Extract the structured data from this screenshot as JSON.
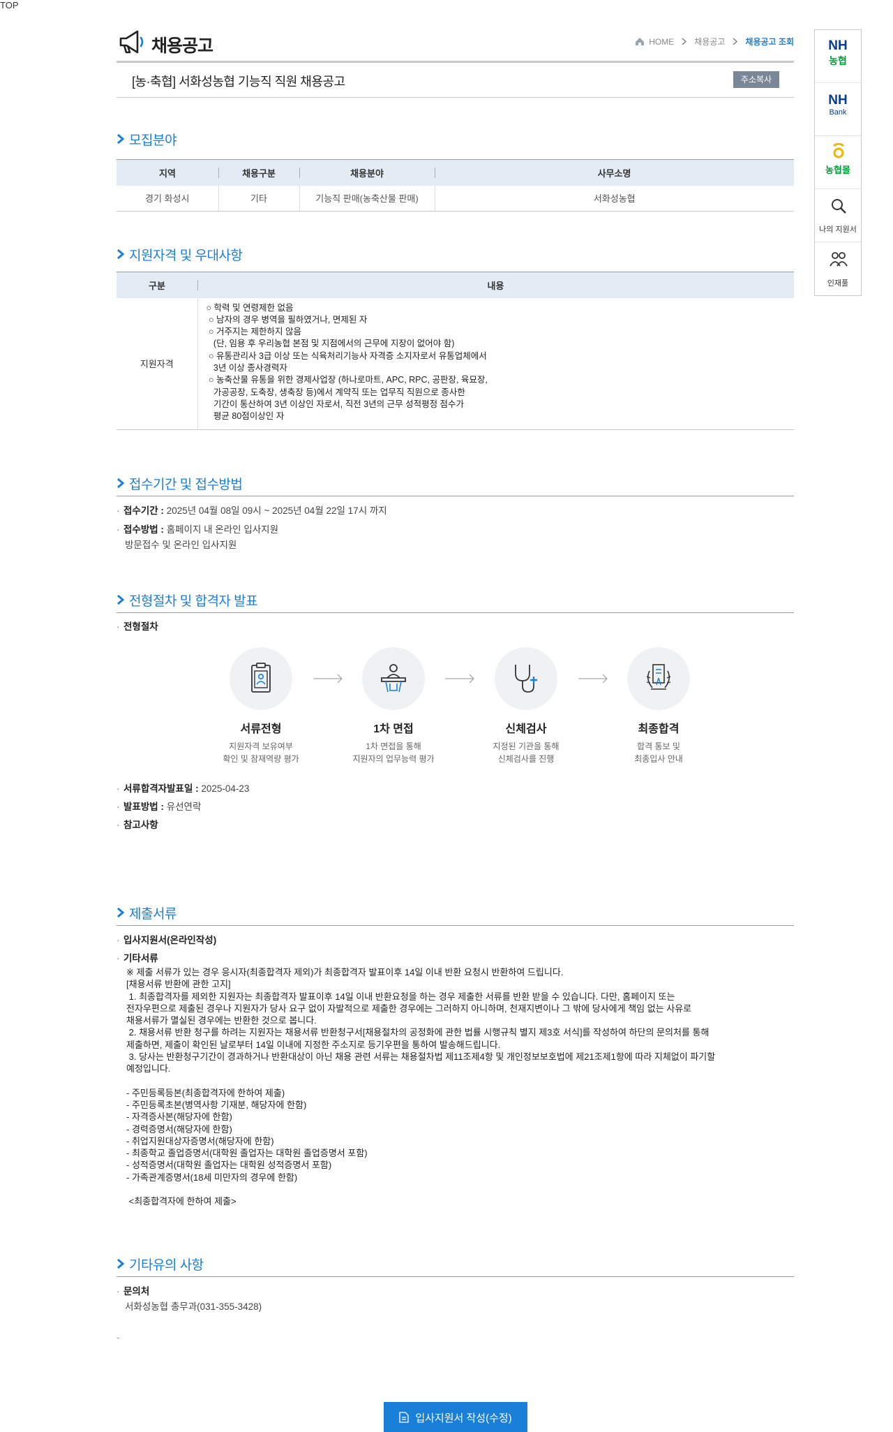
{
  "header": {
    "title": "채용공고",
    "breadcrumb": [
      "HOME",
      "채용공고",
      "채용공고 조회"
    ]
  },
  "job": {
    "title": "[농·축협] 서화성농협 기능직 직원 채용공고",
    "copy_label": "주소복사"
  },
  "recruit": {
    "heading": "모집분야",
    "columns": [
      "지역",
      "채용구분",
      "채용분야",
      "사무소명"
    ],
    "rows": [
      [
        "경기 화성시",
        "기타",
        "기능직 판매(농축산물 판매)",
        "서화성농협"
      ]
    ]
  },
  "qualification": {
    "heading": "지원자격 및 우대사항",
    "columns": [
      "구분",
      "내용"
    ],
    "row_label": "지원자격",
    "lines": [
      "○ 학력 및 연령제한 없음",
      " ○ 남자의 경우 병역을 필하였거나, 면제된 자",
      " ○ 거주지는 제한하지 않음",
      "   (단, 임용 후 우리농협 본점 및 지점에서의 근무에 지장이 없어야 함)",
      " ○ 유통관리사 3급 이상 또는 식육처리기능사 자격증 소지자로서 유통업체에서",
      "   3년 이상 종사경력자",
      " ○ 농축산물 유통을 위한 경제사업장 (하나로마트, APC, RPC, 공판장, 육묘장,",
      "   가공공장, 도축장, 생축장 등)에서 계약직 또는 업무직 직원으로 종사한",
      "   기간이 통산하여 3년 이상인 자로서, 직전 3년의 근무 성적평정 점수가",
      "   평균 80점이상인 자"
    ]
  },
  "reception": {
    "heading": "접수기간 및 접수방법",
    "period_label": "접수기간 :",
    "period_value": "2025년 04월 08일 09시 ~ 2025년 04월 22일 17시 까지",
    "method_label": "접수방법 :",
    "method_value": "홈페이지 내 온라인 입사지원",
    "method_extra": "방문접수 및 온라인 입사지원"
  },
  "process": {
    "heading": "전형절차 및 합격자 발표",
    "sub_label": "전형절차",
    "steps": [
      {
        "name": "서류전형",
        "desc1": "지원자격 보유여부",
        "desc2": "확인 및 잠재역량 평가",
        "icon": "document-id-icon"
      },
      {
        "name": "1차 면접",
        "desc1": "1차 면접을 통해",
        "desc2": "지원자의 업무능력 평가",
        "icon": "interview-podium-icon"
      },
      {
        "name": "신체검사",
        "desc1": "지정된 기관을 통해",
        "desc2": "신체검사를 진행",
        "icon": "stethoscope-icon"
      },
      {
        "name": "최종합격",
        "desc1": "합격 통보 및",
        "desc2": "최종입사 안내",
        "icon": "laurel-certificate-icon"
      }
    ],
    "result_date_label": "서류합격자발표일 :",
    "result_date_value": "2025-04-23",
    "announce_label": "발표방법 :",
    "announce_value": "유선연락",
    "note_label": "참고사항"
  },
  "documents": {
    "heading": "제출서류",
    "item1": "입사지원서(온라인작성)",
    "item2": "기타서류",
    "lines": [
      "※ 제출 서류가 있는 경우 응시자(최종합격자 제외)가 최종합격자 발표이후 14일 이내 반환 요청시 반환하여 드립니다.",
      "[채용서류 반환에 관한 고지]",
      " 1. 최종합격자를 제외한 지원자는 최종합격자 발표이후 14일 이내 반환요청을 하는 경우 제출한 서류를 반환 받을 수 있습니다. 다만, 홈페이지 또는",
      "전자우편으로 제출된 경우나 지원자가 당사 요구 없이 자발적으로 제출한 경우에는 그러하지 아니하며, 천재지변이나 그 밖에 당사에게 책임 없는 사유로",
      "채용서류가 멸실된 경우에는 반환한 것으로 봅니다.",
      " 2. 채용서류 반환 청구를 하려는 지원자는 채용서류 반환청구서[채용절차의 공정화에 관한 법률 시행규칙 별지 제3호 서식]를 작성하여 하단의 문의처를 통해",
      "제출하면, 제출이 확인된 날로부터 14일 이내에 지정한 주소지로 등기우편을 통하여 발송해드립니다.",
      " 3. 당사는 반환청구기간이 경과하거나 반환대상이 아닌 채용 관련 서류는 채용절차법 제11조제4항 및 개인정보보호법에 제21조제1항에 따라 지체없이 파기할",
      "예정입니다.",
      "",
      "- 주민등록등본(최종합격자에 한하여 제출)",
      "- 주민등록초본(병역사항 기재분, 해당자에 한함)",
      "- 자격증사본(해당자에 한함)",
      "- 경력증명서(해당자에 한함)",
      "- 취업지원대상자증명서(해당자에 한함)",
      "- 최종학교 졸업증명서(대학원 졸업자는 대학원 졸업증명서 포함)",
      "- 성적증명서(대학원 졸업자는 대학원 성적증명서 포함)",
      "- 가족관계증명서(18세 미만자의 경우에 한함)",
      "",
      " <최종합격자에 한하여 제출>"
    ]
  },
  "etc": {
    "heading": "기타유의 사항",
    "contact_label": "문의처",
    "contact_value": "서화성농협 총무과(031-355-3428)",
    "trailing": "-"
  },
  "apply_button": "입사지원서 작성(수정)",
  "quick": {
    "nh_top": "NH",
    "nh_bottom": "농협",
    "bank_top": "NH",
    "bank_bottom": "Bank",
    "mall_label": "농협몰",
    "my_apply": "나의 지원서",
    "talent": "인재풀",
    "top": "TOP"
  },
  "colors": {
    "accent": "#1a7fd6",
    "nh_green": "#0b9b3f",
    "nh_blue": "#0a3d91",
    "table_head": "#e3ebf5"
  }
}
